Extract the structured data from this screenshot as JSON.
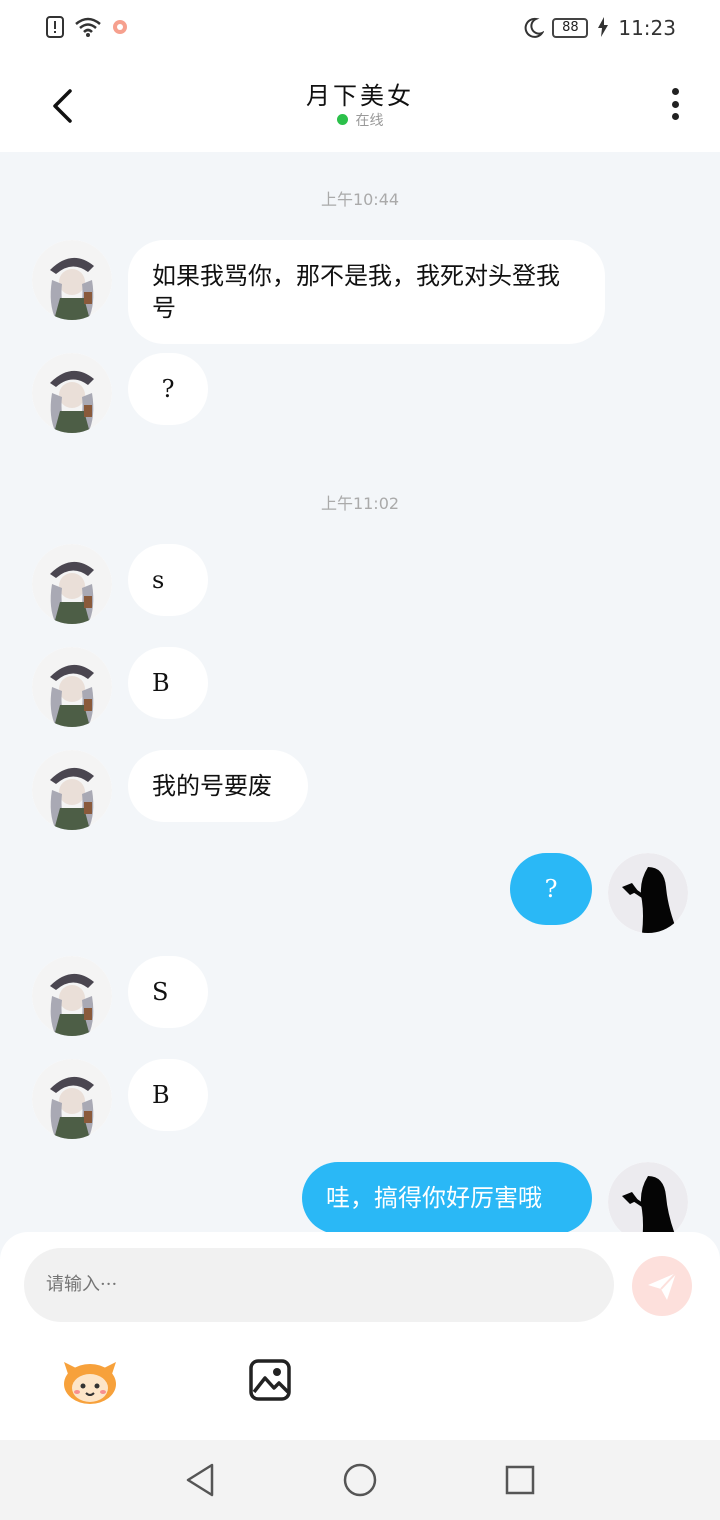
{
  "status_bar": {
    "battery": "88",
    "time": "11:23",
    "icons": [
      "sim-alert-icon",
      "wifi-icon",
      "app-notification-icon",
      "moon-icon",
      "charging-icon"
    ]
  },
  "header": {
    "title": "月下美女",
    "status_text": "在线",
    "status_color": "#2bc04a",
    "icons": [
      "back-icon",
      "more-icon"
    ]
  },
  "chat": {
    "timestamps": [
      "上午10:44",
      "上午11:02"
    ],
    "messages": [
      {
        "side": "in",
        "text": "如果我骂你，那不是我，我死对头登我号"
      },
      {
        "side": "in",
        "text": "?"
      },
      {
        "side": "in",
        "text": "s"
      },
      {
        "side": "in",
        "text": "B"
      },
      {
        "side": "in",
        "text": "我的号要废"
      },
      {
        "side": "out",
        "text": "?"
      },
      {
        "side": "in",
        "text": "S"
      },
      {
        "side": "in",
        "text": "B"
      },
      {
        "side": "out",
        "text": "哇，搞得你好厉害哦"
      }
    ],
    "colors": {
      "incoming_bubble": "#ffffff",
      "outgoing_bubble": "#2ab8f6",
      "background": "#f3f6f9"
    }
  },
  "composer": {
    "placeholder": "请输入···",
    "icons": [
      "send-icon",
      "emoji-mascot-icon",
      "image-icon"
    ]
  },
  "nav_bar": {
    "icons": [
      "nav-back-icon",
      "nav-home-icon",
      "nav-recents-icon"
    ]
  }
}
